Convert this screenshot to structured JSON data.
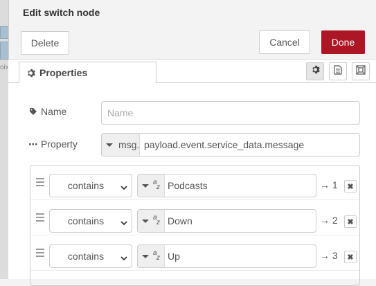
{
  "canvas": {
    "snippet": "oixe"
  },
  "dialog": {
    "title": "Edit switch node",
    "delete_label": "Delete",
    "cancel_label": "Cancel",
    "done_label": "Done",
    "accent_color": "#ad1625"
  },
  "tabs": {
    "properties_label": "Properties",
    "icons": [
      "gear-icon",
      "document-icon",
      "frame-icon"
    ]
  },
  "form": {
    "name": {
      "label": "Name",
      "value": "",
      "placeholder": "Name"
    },
    "property": {
      "label": "Property",
      "type": "msg.",
      "value": "payload.event.service_data.message"
    }
  },
  "rules": [
    {
      "operator": "contains",
      "type_icon": "az",
      "value": "Podcasts",
      "output": "→ 1",
      "delete": "✖"
    },
    {
      "operator": "contains",
      "type_icon": "az",
      "value": "Down",
      "output": "→ 2",
      "delete": "✖"
    },
    {
      "operator": "contains",
      "type_icon": "az",
      "value": "Up",
      "output": "→ 3",
      "delete": "✖"
    }
  ]
}
